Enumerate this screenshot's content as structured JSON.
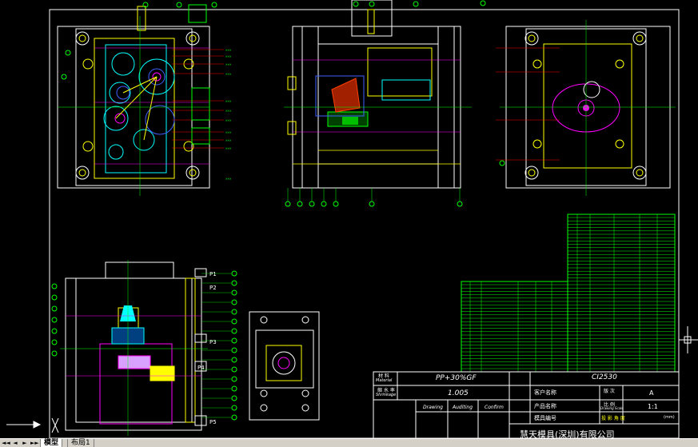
{
  "tabs": [
    "模型",
    "布局1"
  ],
  "title_block": {
    "material_label": "材 料",
    "material_label_en": "Material",
    "material_value": "PP+30%GF",
    "shrinkage_label": "缩 水 率",
    "shrinkage_label_en": "Shrinkage",
    "shrinkage_value": "1.005",
    "mold_no": "CI2530",
    "customer_label": "客户名称",
    "version_label": "版 次",
    "version_value": "A",
    "product_label": "产品名称",
    "scale_label": "比 例",
    "scale_en": "Drawing Scale",
    "scale_value": "1:1",
    "mold_no_label": "模具编号",
    "projection_label": "投 影 角 度",
    "unit_label": "(mm)",
    "drawing_label": "Drawing",
    "auditing_label": "Auditing",
    "confirm_label": "Confirm",
    "company": "慧天模具(深圳)有限公司"
  },
  "colors": {
    "background": "#000000",
    "frame": "#ffffff",
    "green": "#00ff00",
    "cyan": "#00ffff",
    "red": "#ff0000",
    "yellow": "#ffff00",
    "magenta": "#ff00ff",
    "blue": "#4060ff",
    "tabbar": "#d4d0c8"
  },
  "icons": [
    "ucs-icon",
    "crosshair-cursor-icon",
    "tab-nav-first-icon",
    "tab-nav-prev-icon",
    "tab-nav-next-icon",
    "tab-nav-last-icon"
  ]
}
